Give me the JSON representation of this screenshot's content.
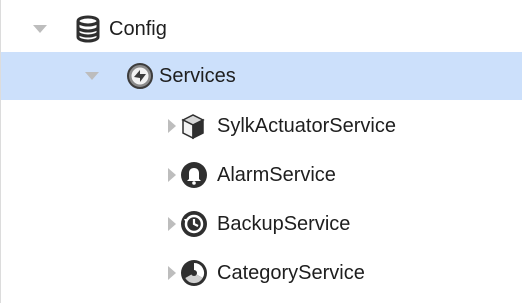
{
  "tree": {
    "items": [
      {
        "label": "Config",
        "icon": "database-icon",
        "expanded": true,
        "selected": false,
        "level": 0
      },
      {
        "label": "Services",
        "icon": "services-icon",
        "expanded": true,
        "selected": true,
        "level": 1
      },
      {
        "label": "SylkActuatorService",
        "icon": "cube-icon",
        "expanded": false,
        "selected": false,
        "level": 2
      },
      {
        "label": "AlarmService",
        "icon": "bell-icon",
        "expanded": false,
        "selected": false,
        "level": 2
      },
      {
        "label": "BackupService",
        "icon": "backup-icon",
        "expanded": false,
        "selected": false,
        "level": 2
      },
      {
        "label": "CategoryService",
        "icon": "category-icon",
        "expanded": false,
        "selected": false,
        "level": 2
      }
    ]
  },
  "colors": {
    "selection": "#cce0fb",
    "toggle": "#bdbdbd",
    "icon_dark": "#2f2f2f"
  }
}
